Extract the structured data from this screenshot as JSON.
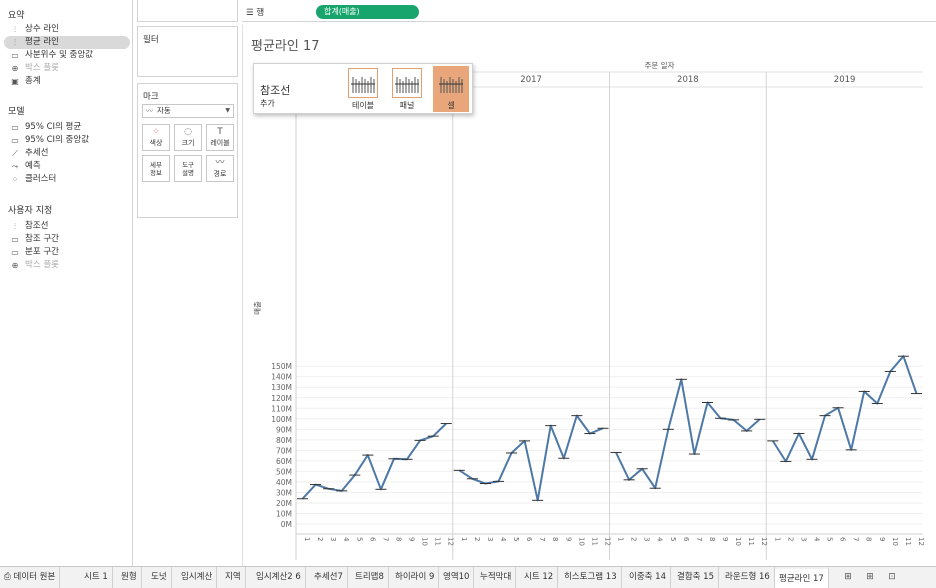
{
  "analytics": {
    "summary_title": "요약",
    "summary_items": [
      {
        "label": "상수 라인",
        "icon": "constant-line-icon",
        "state": "normal"
      },
      {
        "label": "평균 라인",
        "icon": "average-line-icon",
        "state": "selected"
      },
      {
        "label": "사분위수 및 중앙값",
        "icon": "quartile-icon",
        "state": "normal"
      },
      {
        "label": "박스 플롯",
        "icon": "box-plot-icon",
        "state": "disabled"
      },
      {
        "label": "총계",
        "icon": "totals-icon",
        "state": "normal"
      }
    ],
    "model_title": "모델",
    "model_items": [
      {
        "label": "95% CI의 평균",
        "icon": "ci-mean-icon",
        "state": "normal"
      },
      {
        "label": "95% CI의 중앙값",
        "icon": "ci-median-icon",
        "state": "normal"
      },
      {
        "label": "추세선",
        "icon": "trend-line-icon",
        "state": "normal"
      },
      {
        "label": "예측",
        "icon": "forecast-icon",
        "state": "normal"
      },
      {
        "label": "클러스터",
        "icon": "cluster-icon",
        "state": "normal"
      }
    ],
    "custom_title": "사용자 지정",
    "custom_items": [
      {
        "label": "참조선",
        "icon": "reference-line-icon",
        "state": "normal"
      },
      {
        "label": "참조 구간",
        "icon": "reference-band-icon",
        "state": "normal"
      },
      {
        "label": "분포 구간",
        "icon": "distribution-band-icon",
        "state": "normal"
      },
      {
        "label": "박스 플롯",
        "icon": "box-plot-icon",
        "state": "disabled"
      }
    ]
  },
  "filters": {
    "title": "필터"
  },
  "marks": {
    "title": "마크",
    "type_value": "자동",
    "buttons": [
      {
        "label": "색상",
        "label2": "",
        "icon": "color-icon"
      },
      {
        "label": "크기",
        "label2": "",
        "icon": "size-icon"
      },
      {
        "label": "레이블",
        "label2": "",
        "icon": "label-icon"
      },
      {
        "label": "세부",
        "label2": "정보",
        "icon": "detail-icon"
      },
      {
        "label": "도구",
        "label2": "설명",
        "icon": "tooltip-icon"
      },
      {
        "label": "경로",
        "label2": "",
        "icon": "path-icon"
      }
    ]
  },
  "shelf": {
    "rows_label": "행",
    "rows_pill": "합계(매출)"
  },
  "sheet_title": "평균라인 17",
  "popup": {
    "title": "참조선",
    "subtitle": "추가",
    "options": [
      {
        "label": "테이블",
        "selected": false
      },
      {
        "label": "패널",
        "selected": false
      },
      {
        "label": "셀",
        "selected": true
      }
    ]
  },
  "tabs": {
    "datasource": "데이터 원본",
    "sheets": [
      "시트 1",
      "원형",
      "도넛",
      "임시계산",
      "지역",
      "임시계산2 6",
      "추세선7",
      "트리맵8",
      "하이라이 9",
      "영역10",
      "누적막대",
      "시트 12",
      "히스토그램 13",
      "이중축 14",
      "결합축 15",
      "라운드형 16",
      "평균라인 17"
    ],
    "active": "평균라인 17"
  },
  "colors": {
    "line": "#4e79a7",
    "pill": "#17a56d",
    "popup_selected": "#e8a67a"
  },
  "chart_data": {
    "type": "line",
    "column_header": "주문 일자",
    "ylabel": "매출",
    "ylim": [
      0,
      150000000
    ],
    "yticks": [
      "0M",
      "10M",
      "20M",
      "30M",
      "40M",
      "50M",
      "60M",
      "70M",
      "80M",
      "90M",
      "100M",
      "110M",
      "120M",
      "130M",
      "140M",
      "150M"
    ],
    "panes": [
      "2016",
      "2017",
      "2018",
      "2019"
    ],
    "pane_header_visible": [
      false,
      true,
      true,
      true
    ],
    "months": [
      "1",
      "2",
      "3",
      "4",
      "5",
      "6",
      "7",
      "8",
      "9",
      "10",
      "11",
      "12"
    ],
    "series": [
      {
        "year": "2016",
        "values": [
          24000000,
          37500000,
          33500000,
          31500000,
          46500000,
          65500000,
          33000000,
          62000000,
          61500000,
          79500000,
          83500000,
          95500000
        ]
      },
      {
        "year": "2017",
        "values": [
          51000000,
          43000000,
          38500000,
          40500000,
          67500000,
          79000000,
          22500000,
          93500000,
          62500000,
          103000000,
          86000000,
          91000000
        ]
      },
      {
        "year": "2018",
        "values": [
          68000000,
          42000000,
          52500000,
          34000000,
          90000000,
          137500000,
          66500000,
          115500000,
          100500000,
          99000000,
          88500000,
          99500000
        ]
      },
      {
        "year": "2019",
        "values": [
          79000000,
          59500000,
          86000000,
          61500000,
          103000000,
          110500000,
          70500000,
          126000000,
          114500000,
          145000000,
          159500000,
          124000000
        ]
      }
    ]
  }
}
